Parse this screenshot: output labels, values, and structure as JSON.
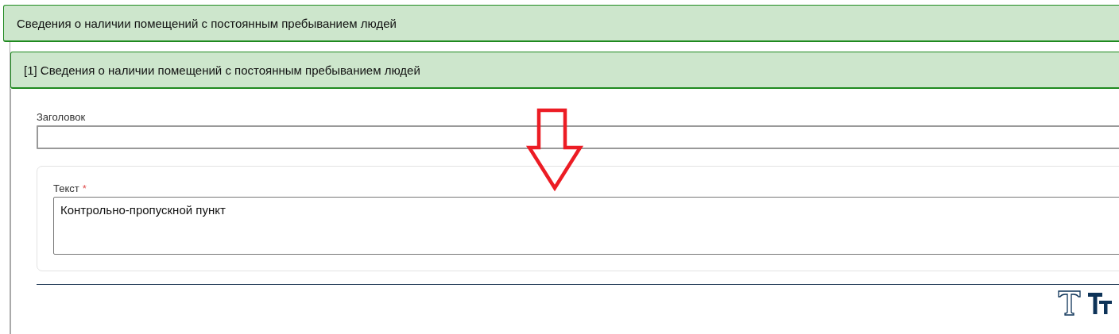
{
  "section": {
    "title": "Сведения о наличии помещений с постоянным пребыванием людей"
  },
  "item": {
    "title": "[1] Сведения о наличии помещений с постоянным пребыванием людей"
  },
  "title_field": {
    "label": "Заголовок"
  },
  "text_field": {
    "label": "Текст",
    "required_mark": "*",
    "value": "Контрольно-пропускной пункт"
  }
}
